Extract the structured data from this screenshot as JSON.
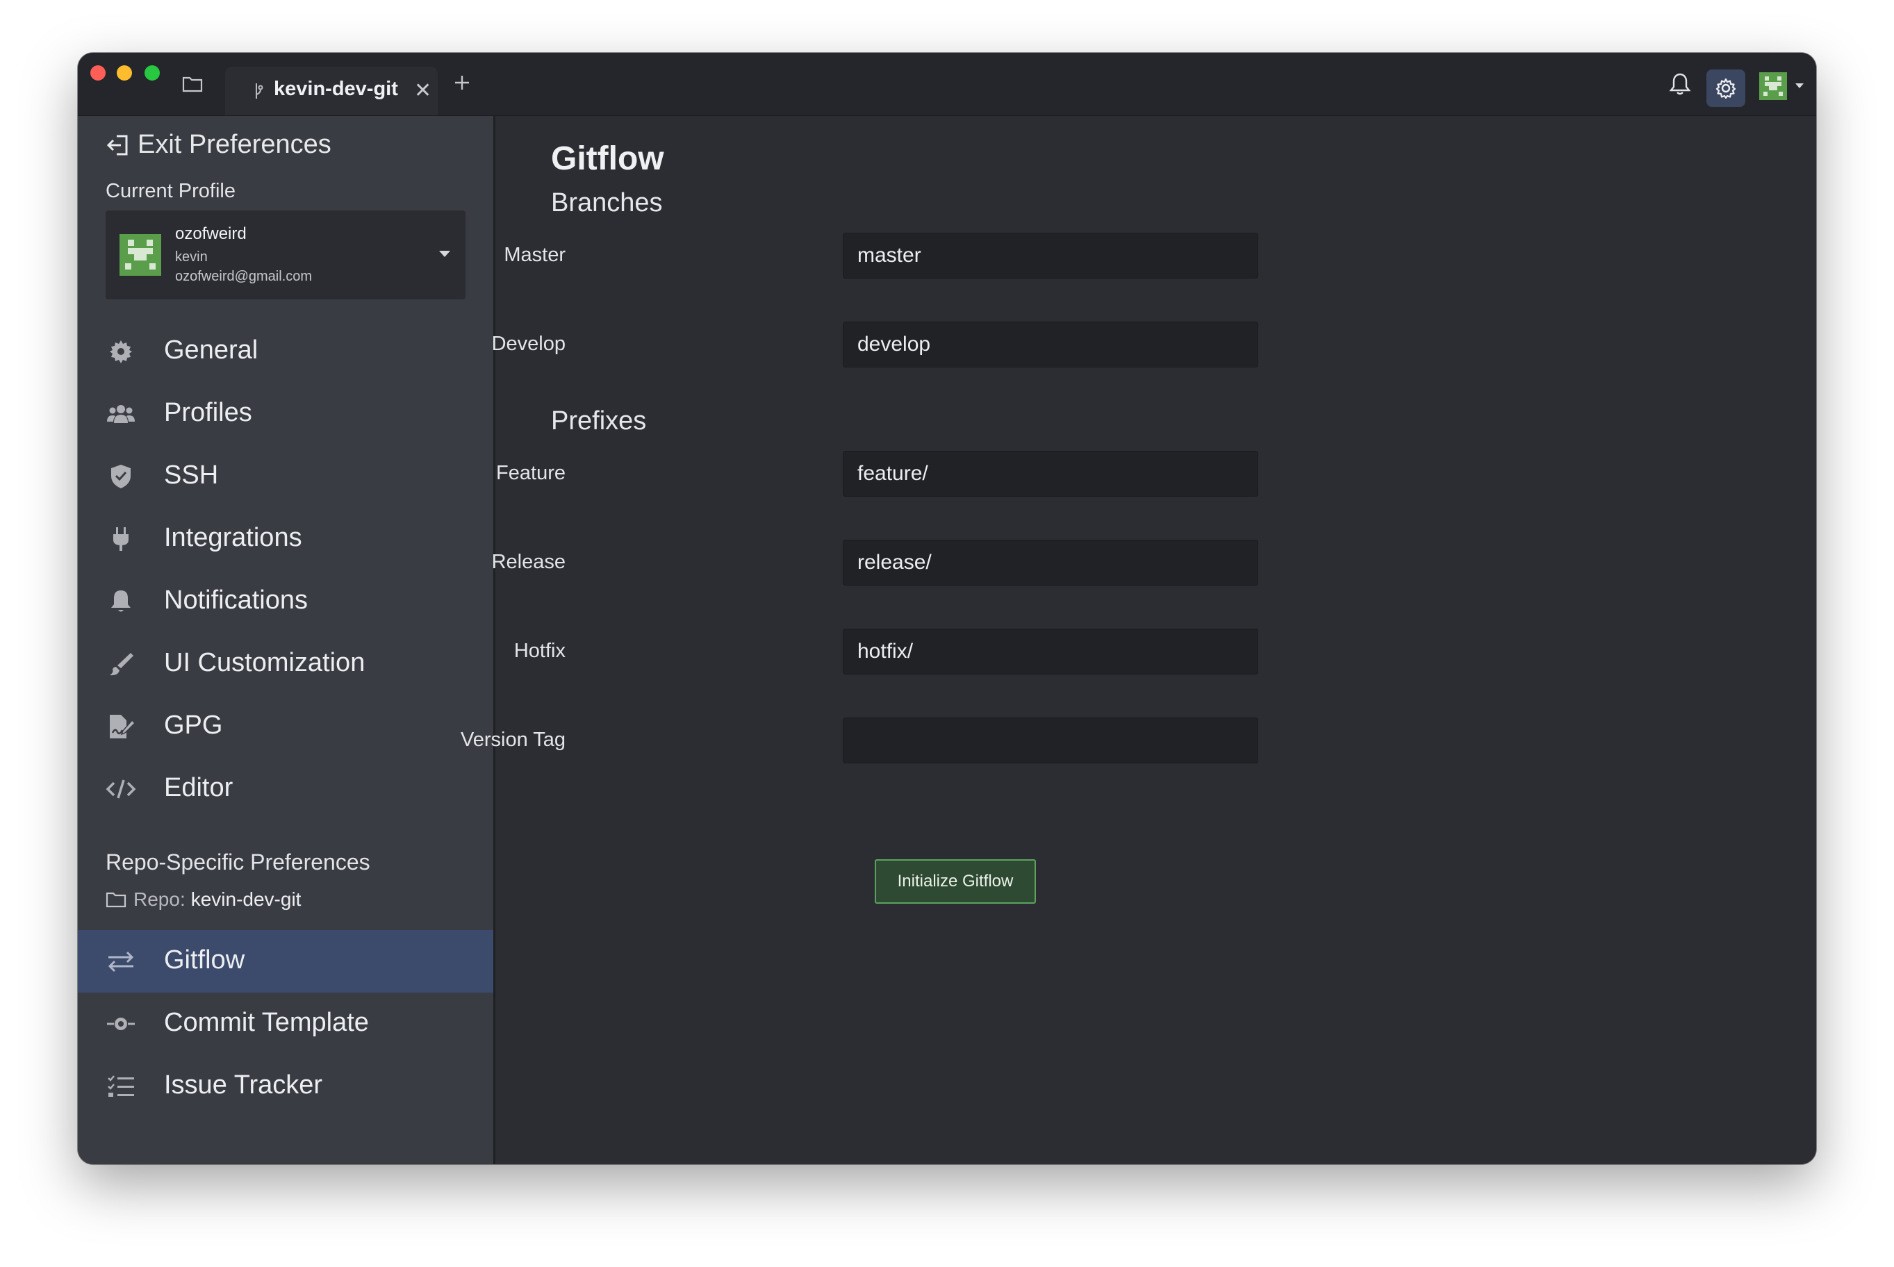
{
  "titlebar": {
    "tab_label": "kevin-dev-git",
    "tab_close": "✕"
  },
  "sidebar": {
    "exit_label": "Exit Preferences",
    "current_profile_label": "Current Profile",
    "profile": {
      "name": "ozofweird",
      "username": "kevin",
      "email": "ozofweird@gmail.com"
    },
    "items": [
      {
        "label": "General",
        "icon": "gear-icon"
      },
      {
        "label": "Profiles",
        "icon": "users-icon"
      },
      {
        "label": "SSH",
        "icon": "shield-icon"
      },
      {
        "label": "Integrations",
        "icon": "plug-icon"
      },
      {
        "label": "Notifications",
        "icon": "bell-icon"
      },
      {
        "label": "UI Customization",
        "icon": "brush-icon"
      },
      {
        "label": "GPG",
        "icon": "signature-icon"
      },
      {
        "label": "Editor",
        "icon": "code-icon"
      }
    ],
    "repo_header": "Repo-Specific Preferences",
    "repo_key": "Repo:",
    "repo_name": "kevin-dev-git",
    "repo_items": [
      {
        "label": "Gitflow",
        "icon": "arrows-icon",
        "active": true
      },
      {
        "label": "Commit Template",
        "icon": "commit-icon"
      },
      {
        "label": "Issue Tracker",
        "icon": "checklist-icon"
      }
    ]
  },
  "main": {
    "title": "Gitflow",
    "branches_header": "Branches",
    "prefixes_header": "Prefixes",
    "fields": {
      "master": {
        "label": "Master",
        "value": "master"
      },
      "develop": {
        "label": "Develop",
        "value": "develop"
      },
      "feature": {
        "label": "Feature",
        "value": "feature/"
      },
      "release": {
        "label": "Release",
        "value": "release/"
      },
      "hotfix": {
        "label": "Hotfix",
        "value": "hotfix/"
      },
      "version_tag": {
        "label": "Version Tag",
        "value": ""
      }
    },
    "init_button": "Initialize Gitflow"
  },
  "colors": {
    "accent_active": "#3c4a6b",
    "button_green_border": "#5aa35f",
    "sidebar_bg": "#3a3c43",
    "main_bg": "#2b2d33"
  }
}
